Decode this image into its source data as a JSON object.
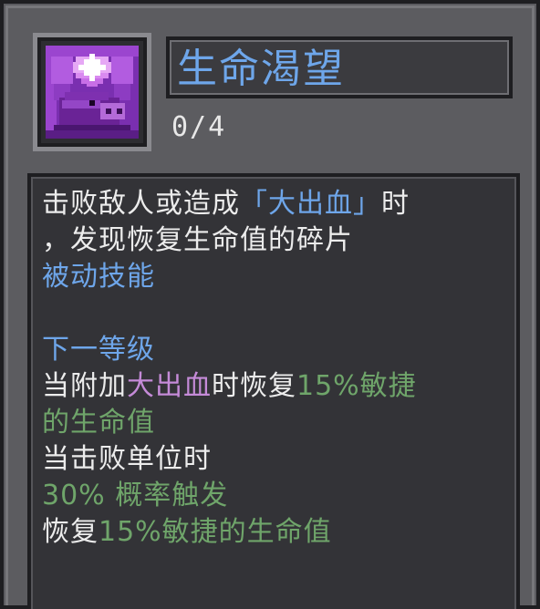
{
  "skill": {
    "icon": "heart-pig-icon",
    "title": "生命渴望",
    "level": "0/4"
  },
  "description": {
    "line1_a": "击败敌人或造成",
    "line1_b": "「大出血」",
    "line1_c": "时",
    "line2": "，发现恢复生命值的碎片",
    "type_label": "被动技能"
  },
  "next_level": {
    "heading": "下一等级",
    "line1_a": "当附加",
    "line1_b": "大出血",
    "line1_c": "时恢复",
    "line1_d": "15%敏捷",
    "line2": "的生命值",
    "line3": "当击败单位时",
    "line4": "30% 概率触发",
    "line5_a": "恢复",
    "line5_b": "15%敏捷的生命值"
  },
  "colors": {
    "title_blue": "#6ea6ea",
    "bleed_purple": "#c58bd8",
    "stat_green": "#6fa56a",
    "text_white": "#ececec"
  }
}
